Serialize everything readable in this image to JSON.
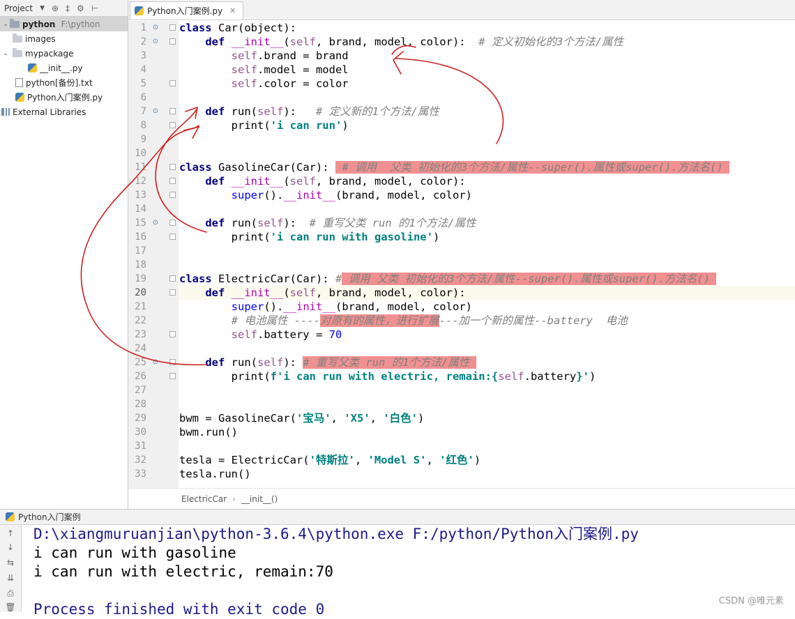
{
  "project_panel": {
    "header_label": "Project",
    "tree": [
      {
        "name": "python",
        "path": "F:\\python",
        "type": "root",
        "expanded": true
      },
      {
        "name": "images",
        "type": "folder",
        "expanded": false
      },
      {
        "name": "mypackage",
        "type": "folder",
        "expanded": true
      },
      {
        "name": "__init__.py",
        "type": "py"
      },
      {
        "name": "python[备份].txt",
        "type": "txt"
      },
      {
        "name": "Python入门案例.py",
        "type": "py"
      },
      {
        "name": "External Libraries",
        "type": "lib"
      }
    ]
  },
  "editor": {
    "active_tab": "Python入门案例.py",
    "current_line": 20,
    "breadcrumb": [
      "ElectricCar",
      "__init__()"
    ]
  },
  "run_panel": {
    "title": "Python入门案例",
    "output": [
      "D:\\xiangmuruanjian\\python-3.6.4\\python.exe F:/python/Python入门案例.py",
      "i can run with gasoline",
      "i can run with electric, remain:70",
      "",
      "Process finished with exit code 0"
    ]
  },
  "watermark": "CSDN @唯元素",
  "colors": {
    "keyword": "#000080",
    "self": "#94558d",
    "string": "#008080",
    "comment": "#808080",
    "highlight": "#f09090",
    "annotation_ink": "#d02020"
  }
}
